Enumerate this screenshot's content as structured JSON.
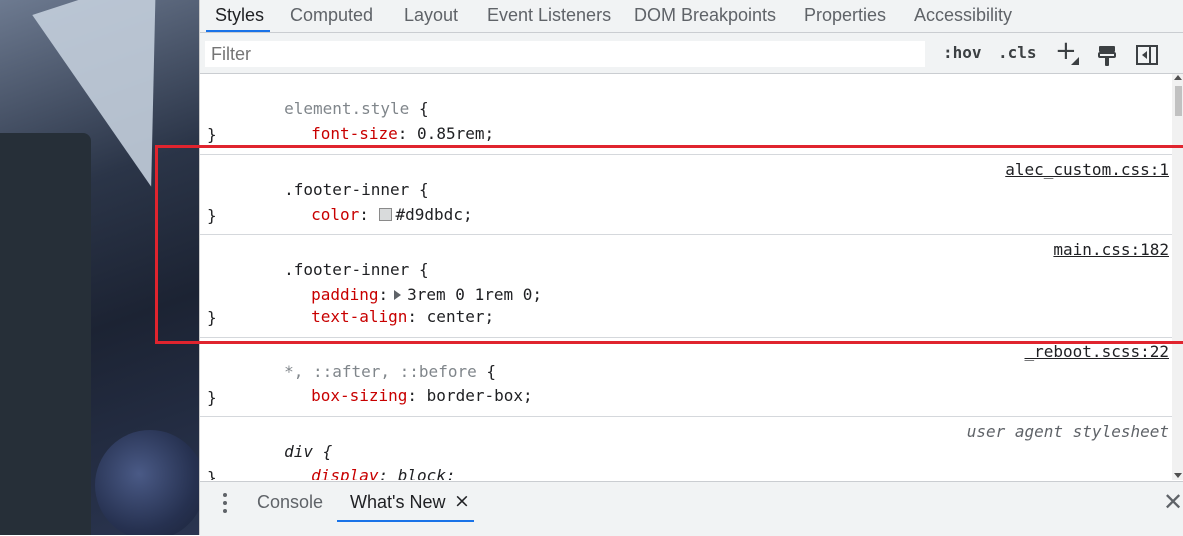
{
  "tabs": [
    {
      "label": "Styles",
      "active": true
    },
    {
      "label": "Computed",
      "active": false
    },
    {
      "label": "Layout",
      "active": false
    },
    {
      "label": "Event Listeners",
      "active": false
    },
    {
      "label": "DOM Breakpoints",
      "active": false
    },
    {
      "label": "Properties",
      "active": false
    },
    {
      "label": "Accessibility",
      "active": false
    }
  ],
  "filter": {
    "placeholder": "Filter",
    "value": ""
  },
  "filter_buttons": {
    "hov": ":hov",
    "cls": ".cls",
    "new_rule": "+"
  },
  "icons": {
    "new_rule": "plus-icon",
    "rendering": "paint-brush-icon",
    "toggle_sidebar": "sidebar-toggle-icon",
    "drawer_menu": "kebab-menu-icon",
    "close": "close-icon"
  },
  "rules": [
    {
      "selector": "element.style",
      "source": "",
      "props": [
        {
          "name": "font-size",
          "value": "0.85rem"
        }
      ]
    },
    {
      "selector": ".footer-inner",
      "source": "alec_custom.css:1",
      "props": [
        {
          "name": "color",
          "value": "#d9dbdc",
          "swatch": "#d9dbdc"
        }
      ]
    },
    {
      "selector": ".footer-inner",
      "source": "main.css:182",
      "props": [
        {
          "name": "padding",
          "value": "3rem 0 1rem 0",
          "expandable": true
        },
        {
          "name": "text-align",
          "value": "center"
        }
      ]
    },
    {
      "selector": "*, ::after, ::before",
      "source": "_reboot.scss:22",
      "props": [
        {
          "name": "box-sizing",
          "value": "border-box"
        }
      ]
    },
    {
      "selector": "div",
      "source": "user agent stylesheet",
      "props": [
        {
          "name": "display",
          "value": "block"
        }
      ]
    }
  ],
  "open_brace": "{",
  "close_brace": "}",
  "colon": ":",
  "semicolon": ";",
  "drawer": {
    "tabs": [
      {
        "label": "Console",
        "active": false
      },
      {
        "label": "What's New",
        "active": true,
        "close": "×"
      }
    ],
    "close": "✕"
  },
  "colors": {
    "accent": "#1a73e8",
    "highlight": "#e0242e",
    "property": "#c80000",
    "swatch": "#d9dbdc"
  }
}
